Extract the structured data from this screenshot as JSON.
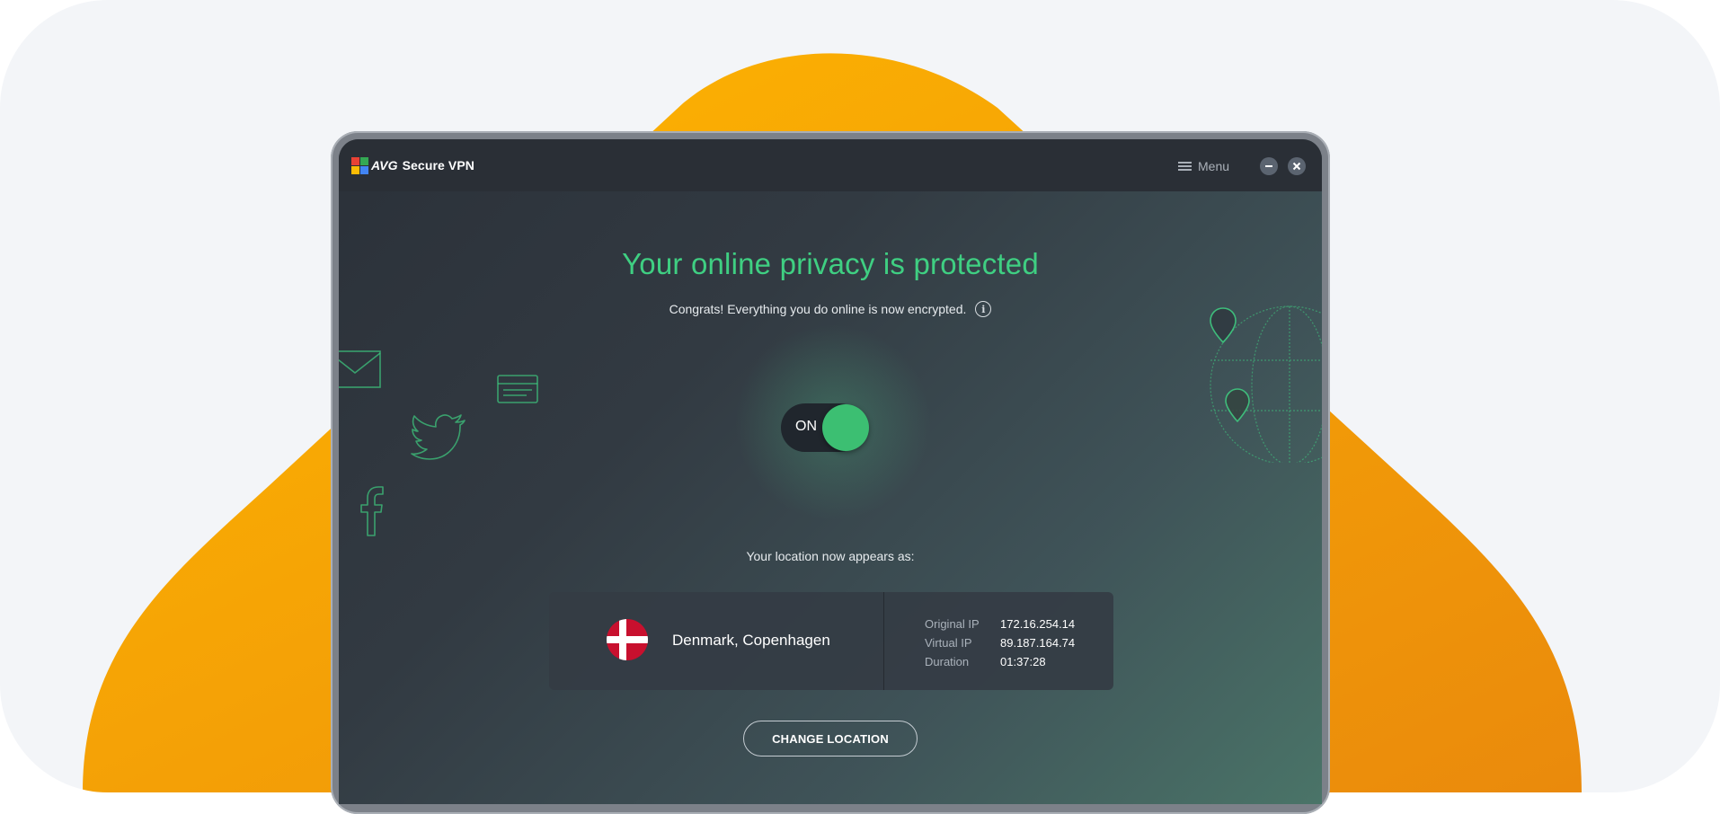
{
  "app": {
    "brand": "AVG",
    "title": "Secure VPN"
  },
  "window": {
    "menu_label": "Menu"
  },
  "status": {
    "headline": "Your online privacy is protected",
    "subline": "Congrats! Everything you do online is now encrypted."
  },
  "toggle": {
    "label": "ON"
  },
  "location": {
    "caption": "Your location now appears as:",
    "name": "Denmark, Copenhagen",
    "details": [
      {
        "label": "Original IP",
        "value": "172.16.254.14"
      },
      {
        "label": "Virtual IP",
        "value": "89.187.164.74"
      },
      {
        "label": "Duration",
        "value": "01:37:28"
      }
    ]
  },
  "actions": {
    "change_location": "CHANGE LOCATION"
  },
  "colors": {
    "accent_green": "#3fcf82",
    "toggle_on": "#3cbf72",
    "backdrop_orange": "#ffb000",
    "flag_red": "#c8102e"
  },
  "icons": [
    "avg-logo-icon",
    "menu-icon",
    "minimize-icon",
    "close-icon",
    "info-icon",
    "mail-icon",
    "credit-card-icon",
    "twitter-icon",
    "facebook-icon",
    "map-pin-icon",
    "globe-icon",
    "denmark-flag-icon"
  ]
}
